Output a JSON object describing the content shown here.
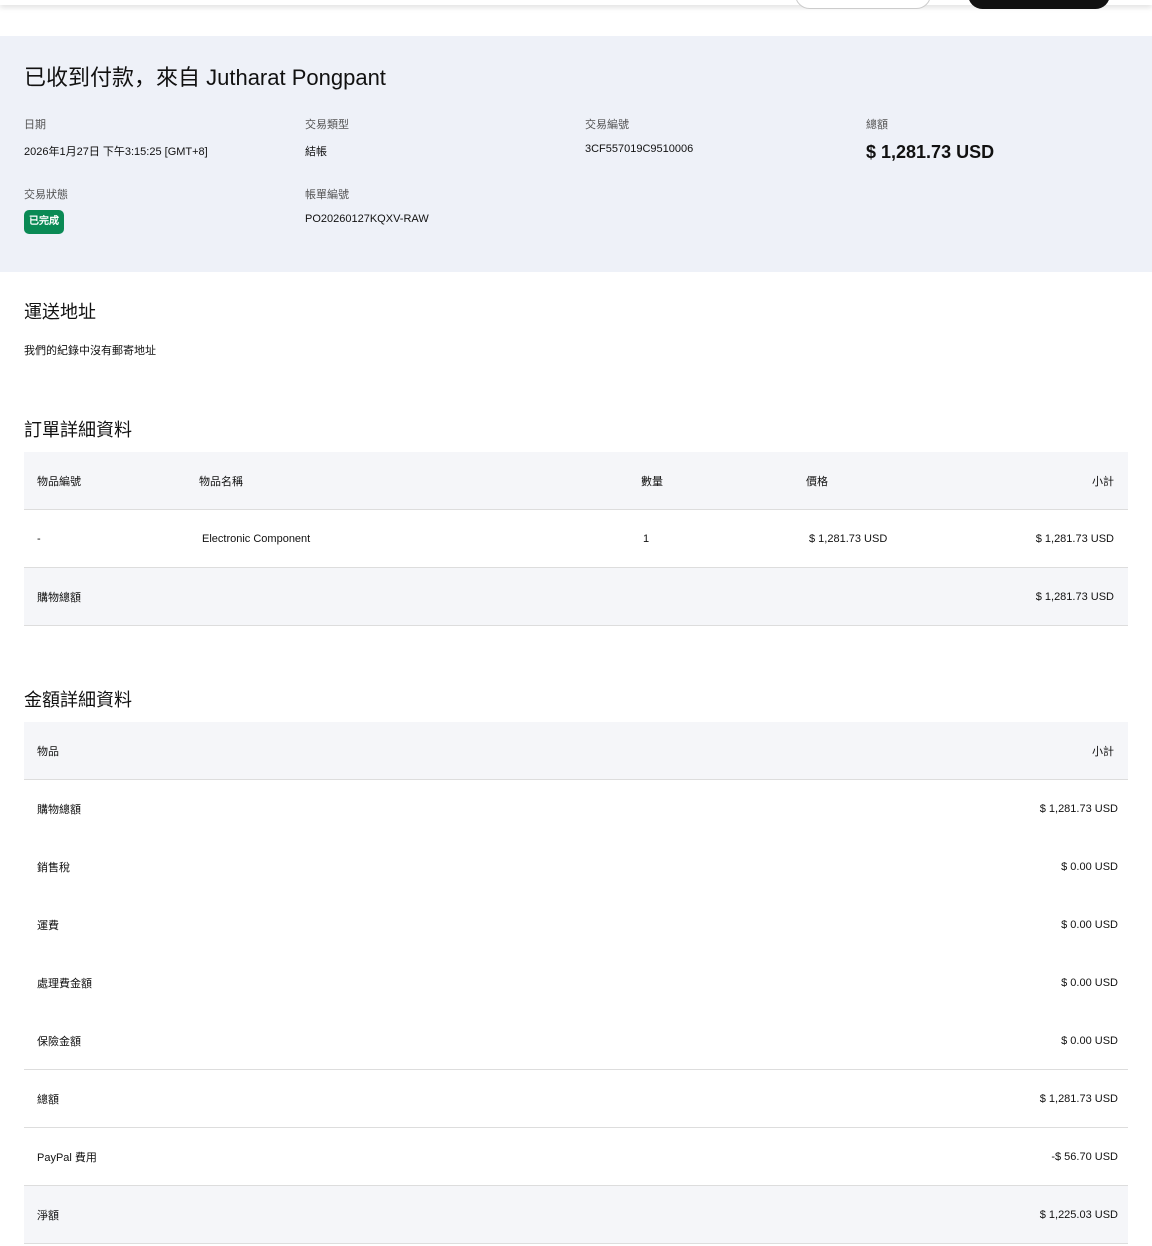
{
  "header": {
    "title": "已收到付款，來自 Jutharat Pongpant",
    "date_label": "日期",
    "date": "2026年1月27日 下午3:15:25 [GMT+8]",
    "type_label": "交易類型",
    "type": "結帳",
    "id_label": "交易編號",
    "id": "3CF557019C9510006",
    "total_label": "總額",
    "total": "$ 1,281.73 USD",
    "status_label": "交易狀態",
    "status": "已完成",
    "invoice_label": "帳單編號",
    "invoice": "PO20260127KQXV-RAW"
  },
  "shipping": {
    "heading": "運送地址",
    "note": "我們的紀錄中沒有郵寄地址"
  },
  "order": {
    "heading": "訂單詳細資料",
    "columns": [
      "物品編號",
      "物品名稱",
      "數量",
      "價格",
      "小計"
    ],
    "item": {
      "number": "-",
      "name": "Electronic Component",
      "qty": "1",
      "price": "$ 1,281.73 USD",
      "subtotal": "$ 1,281.73 USD"
    },
    "total_label": "購物總額",
    "total": "$ 1,281.73 USD"
  },
  "amount": {
    "heading": "金額詳細資料",
    "col_item": "物品",
    "col_subtotal": "小計",
    "rows": [
      {
        "label": "購物總額",
        "value": "$ 1,281.73 USD"
      },
      {
        "label": "銷售稅",
        "value": "$ 0.00 USD"
      },
      {
        "label": "運費",
        "value": "$ 0.00 USD"
      },
      {
        "label": "處理費金額",
        "value": "$ 0.00 USD"
      },
      {
        "label": "保險金額",
        "value": "$ 0.00 USD"
      },
      {
        "label": "總額",
        "value": "$ 1,281.73 USD"
      },
      {
        "label": "PayPal 費用",
        "value": "-$ 56.70 USD"
      },
      {
        "label": "淨額",
        "value": "$ 1,225.03 USD"
      }
    ]
  },
  "colors": {
    "band": "#eef1f8",
    "badge": "#0a8a55"
  }
}
